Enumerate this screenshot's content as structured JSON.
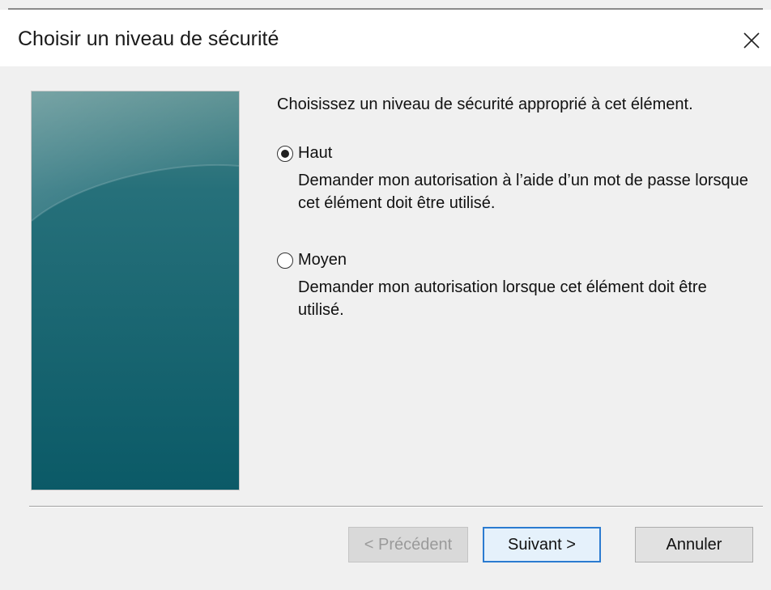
{
  "window": {
    "title": "Choisir un niveau de sécurité",
    "close_glyph": "✕"
  },
  "content": {
    "prompt": "Choisissez un niveau de sécurité approprié à cet élément.",
    "options": [
      {
        "label": "Haut",
        "description": "Demander mon autorisation à l’aide d’un mot de passe lorsque cet élément doit être utilisé.",
        "selected": true
      },
      {
        "label": "Moyen",
        "description": "Demander mon autorisation lorsque cet élément doit être utilisé.",
        "selected": false
      }
    ]
  },
  "buttons": {
    "previous_label": "< Précédent",
    "previous_enabled": false,
    "next_label": "Suivant >",
    "cancel_label": "Annuler"
  },
  "colors": {
    "panel_top": "#3f7d80",
    "panel_bottom": "#0c5b68",
    "default_button_border": "#2b7bd0"
  },
  "icons": {
    "close": "close-icon",
    "radio_selected": "radio-selected-icon",
    "radio_unselected": "radio-unselected-icon"
  }
}
